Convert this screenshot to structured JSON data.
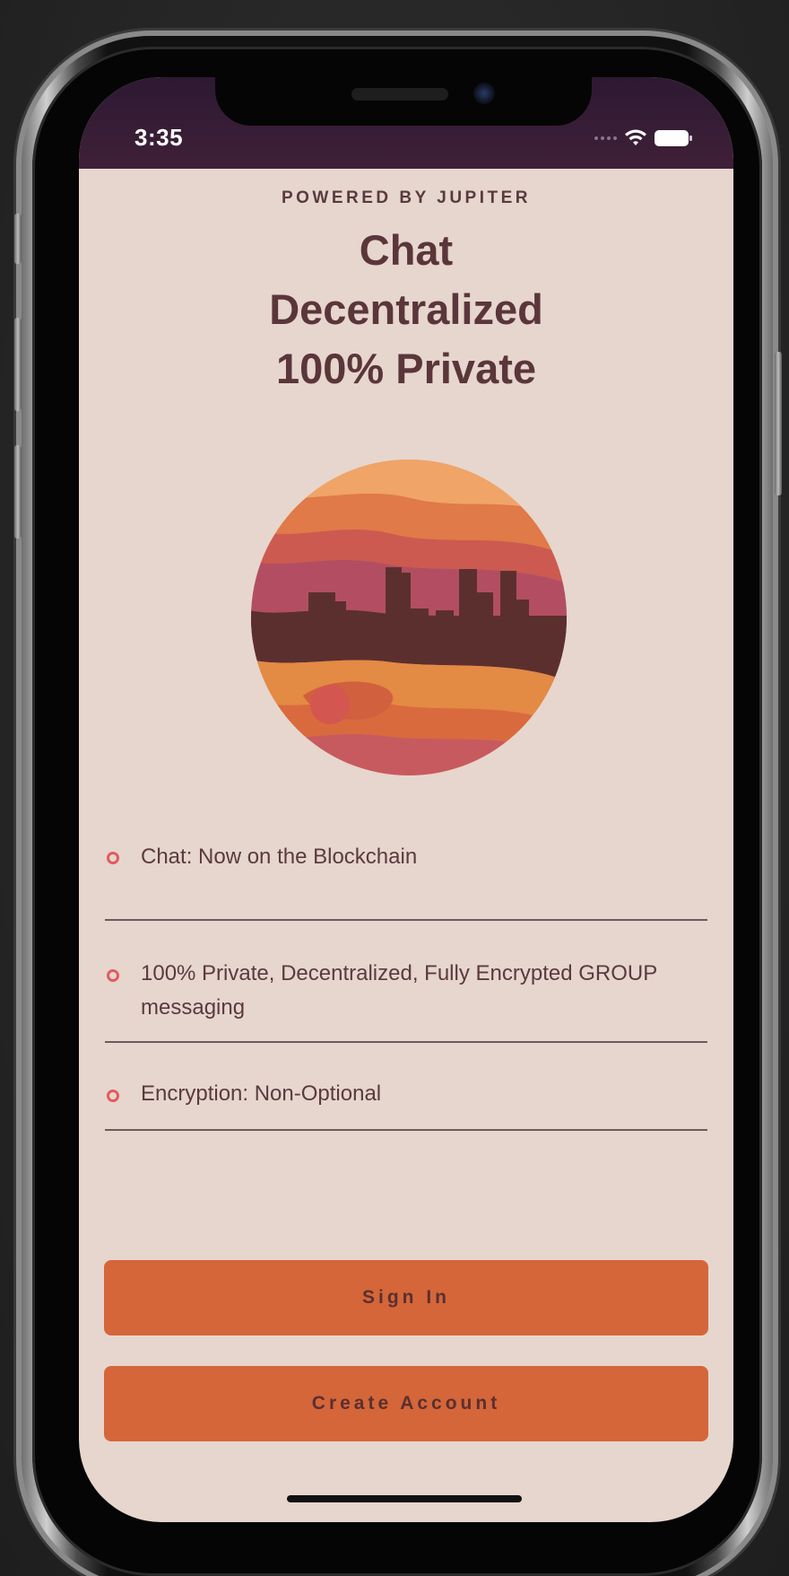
{
  "status_bar": {
    "time": "3:35"
  },
  "header": {
    "powered_by": "POWERED BY JUPITER",
    "headline_lines": [
      "Chat",
      "Decentralized",
      "100% Private"
    ]
  },
  "features": [
    {
      "text": "Chat: Now on the Blockchain"
    },
    {
      "text": "100% Private, Decentralized, Fully Encrypted GROUP messaging"
    },
    {
      "text": "Encryption: Non-Optional"
    }
  ],
  "buttons": {
    "sign_in": "Sign In",
    "create_account": "Create Account"
  },
  "colors": {
    "background": "#e6d6ce",
    "status_bar": "#2d1932",
    "primary_button": "#d4663a",
    "heading_text": "#5a363a",
    "bullet": "#e45a5e"
  },
  "icons": {
    "logo": "jupiter-planet-city-logo",
    "wifi": "wifi-icon",
    "battery": "battery-icon",
    "signal": "signal-icon"
  }
}
